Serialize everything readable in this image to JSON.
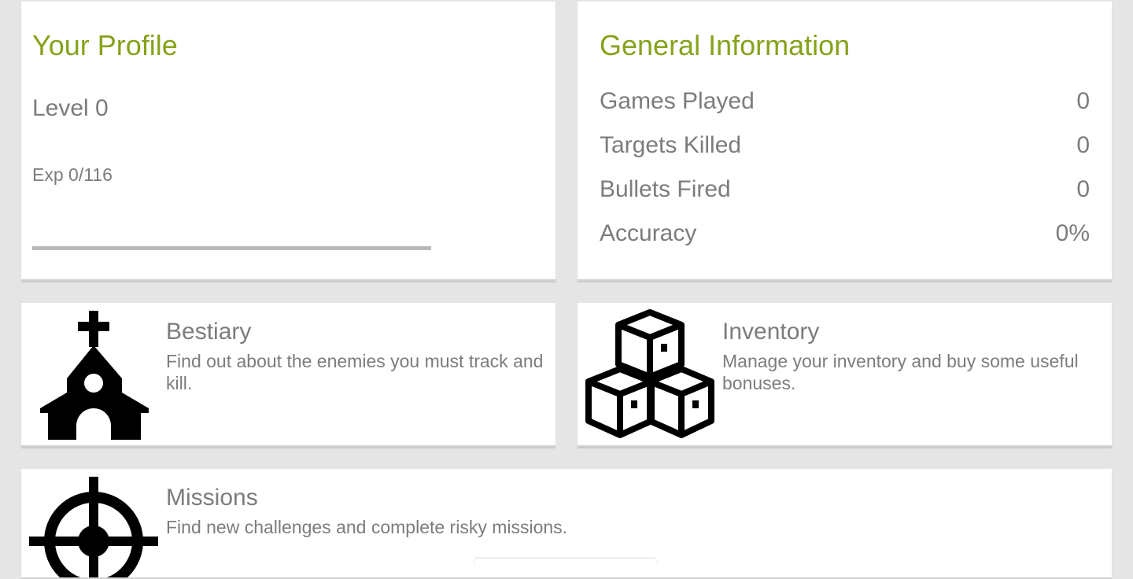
{
  "profile": {
    "title": "Your Profile",
    "level_label": "Level 0",
    "exp_label": "Exp 0/116",
    "exp_progress": 0.0
  },
  "general": {
    "title": "General Information",
    "stats": [
      {
        "label": "Games Played",
        "value": "0"
      },
      {
        "label": "Targets Killed",
        "value": "0"
      },
      {
        "label": "Bullets Fired",
        "value": "0"
      },
      {
        "label": "Accuracy",
        "value": "0%"
      }
    ]
  },
  "menu": {
    "bestiary": {
      "icon": "church-icon",
      "title": "Bestiary",
      "description": "Find out about the enemies you must track and kill."
    },
    "inventory": {
      "icon": "boxes-icon",
      "title": "Inventory",
      "description": "Manage your inventory and buy some useful bonuses."
    },
    "missions": {
      "icon": "crosshair-icon",
      "title": "Missions",
      "description": "Find new challenges and complete risky missions."
    }
  },
  "colors": {
    "accent": "#86a21a",
    "text_grey": "#7c7c7c",
    "background": "#e5e5e5",
    "card": "#ffffff",
    "progress_track": "#b8b8b8"
  }
}
